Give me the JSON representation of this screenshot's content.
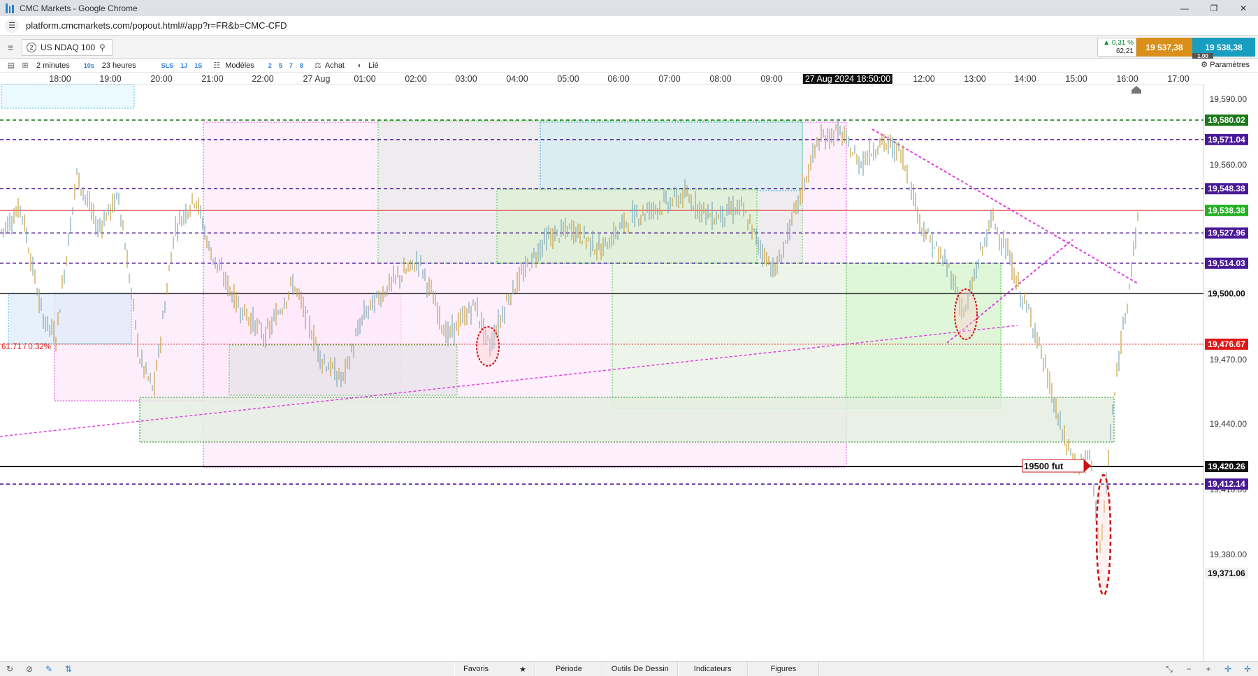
{
  "window": {
    "title": "CMC Markets - Google Chrome",
    "minimize": "—",
    "maximize": "❐",
    "close": "✕"
  },
  "address": {
    "url": "platform.cmcmarkets.com/popout.html#/app?r=FR&b=CMC-CFD",
    "site_icon": "tune-icon"
  },
  "instrument": {
    "tab_number": "2",
    "name": "US NDAQ 100",
    "change_pct": "▲ 0,31 %",
    "change_pts": "62,21",
    "bid": "19 537,38",
    "ask": "19 538,38",
    "spread": "1,00",
    "bid_color": "#d98f1a",
    "ask_color": "#1a9ec0"
  },
  "toolbar": {
    "interval": "2 minutes",
    "chip_10s": "10s",
    "duration": "23 heures",
    "chip_sls": "SLS",
    "chip_1j": "1J",
    "chip_1s": "1S",
    "models": "Modèles",
    "n2": "2",
    "n5": "5",
    "n7": "7",
    "n8": "8",
    "buy": "Achat",
    "linked": "Lié",
    "settings": "Paramètres"
  },
  "time_axis": {
    "labels": [
      "18:00",
      "19:00",
      "20:00",
      "21:00",
      "22:00",
      "27 Aug",
      "01:00",
      "02:00",
      "03:00",
      "04:00",
      "05:00",
      "06:00",
      "07:00",
      "08:00",
      "09:00",
      "12:00",
      "13:00",
      "14:00",
      "15:00",
      "16:00",
      "17:00"
    ],
    "crosshair": "27 Aug 2024 18:50:00"
  },
  "chart_data": {
    "type": "line",
    "instrument": "US NDAQ 100",
    "interval": "2 minutes",
    "ylim": [
      19365,
      19602
    ],
    "y_ticks": [
      "19,590.00",
      "19,560.00",
      "19,470.00",
      "19,440.00",
      "19,410.00",
      "19,380.00"
    ],
    "price_lines": [
      {
        "label": "19,580.02",
        "value": 19580.02,
        "color": "#1a7a1a",
        "style": "dashed"
      },
      {
        "label": "19,571.04",
        "value": 19571.04,
        "color": "#4a1a99",
        "style": "dashed"
      },
      {
        "label": "19,548.38",
        "value": 19548.38,
        "color": "#4a1a99",
        "style": "dashed"
      },
      {
        "label": "19,538.38",
        "value": 19538.38,
        "color": "#22b022",
        "style": "solid"
      },
      {
        "label": "19,527.96",
        "value": 19527.96,
        "color": "#4a1a99",
        "style": "dashed"
      },
      {
        "label": "19,514.03",
        "value": 19514.03,
        "color": "#4a1a99",
        "style": "dashed"
      },
      {
        "label": "19,500.00",
        "value": 19500.0,
        "color": "#333333",
        "style": "solid"
      },
      {
        "label": "19,476.67",
        "value": 19476.67,
        "color": "#e01818",
        "style": "dotted"
      },
      {
        "label": "19,420.26",
        "value": 19420.26,
        "color": "#111111",
        "style": "solid"
      },
      {
        "label": "19,412.14",
        "value": 19412.14,
        "color": "#4a1a99",
        "style": "dashed"
      },
      {
        "label": "19,371.06",
        "value": 19371.06,
        "color": "#333333",
        "style": "none"
      }
    ],
    "fib_label": "61.71 / 0.32%",
    "annotation": "19500 fut",
    "last_price": 19538.38
  }
}
